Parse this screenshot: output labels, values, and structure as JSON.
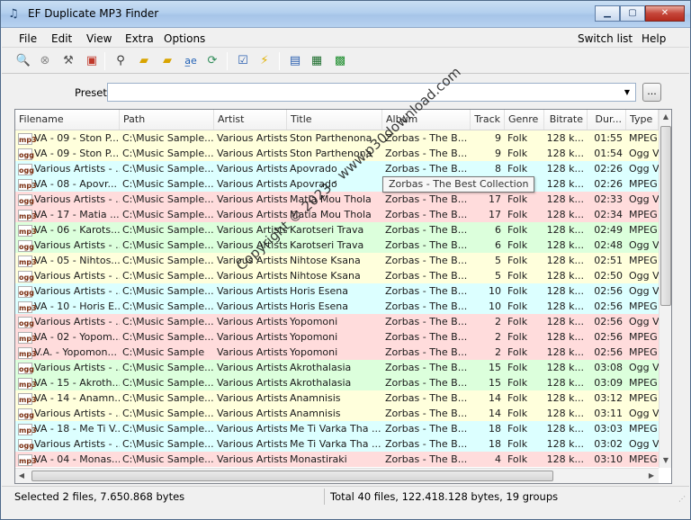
{
  "window": {
    "title": "EF Duplicate MP3 Finder",
    "app_icon": "music-notes-icon"
  },
  "menu": {
    "items": [
      "File",
      "Edit",
      "View",
      "Extra",
      "Options"
    ],
    "switch_list": "Switch list",
    "help": "Help"
  },
  "toolbar": {
    "icons": [
      "search-icon",
      "stop-icon",
      "hammer-icon",
      "file-clear-icon",
      "binoculars-icon",
      "folder-open-icon",
      "folder-add-icon",
      "spell-check-icon",
      "refresh-icon",
      "checklist-icon",
      "lightning-icon",
      "document-icon",
      "export-icon",
      "save-icon"
    ]
  },
  "preset": {
    "label": "Preset",
    "value": "",
    "button": "..."
  },
  "columns": [
    "Filename",
    "Path",
    "Artist",
    "Title",
    "Album",
    "Track",
    "Genre",
    "Bitrate",
    "Dur...",
    "Type"
  ],
  "rows": [
    {
      "icon": "mp3",
      "filename": "VA - 09 - Ston P...",
      "path": "C:\\Music Sample...",
      "artist": "Various Artists",
      "title": "Ston Parthenona",
      "album": "Zorbas - The B...",
      "track": "9",
      "genre": "Folk",
      "bitrate": "128 k...",
      "duration": "01:55",
      "type": "MPEG",
      "color": "yellow"
    },
    {
      "icon": "ogg",
      "filename": "VA - 09 - Ston P...",
      "path": "C:\\Music Sample...",
      "artist": "Various Artists",
      "title": "Ston Parthenona",
      "album": "Zorbas - The B...",
      "track": "9",
      "genre": "Folk",
      "bitrate": "128 k...",
      "duration": "01:54",
      "type": "Ogg V",
      "color": "yellow"
    },
    {
      "icon": "ogg",
      "filename": "Various Artists - ...",
      "path": "C:\\Music Sample...",
      "artist": "Various Artists",
      "title": "Apovrado",
      "album": "Zorbas - The B...",
      "track": "8",
      "genre": "Folk",
      "bitrate": "128 k...",
      "duration": "02:26",
      "type": "Ogg V",
      "color": "cyan"
    },
    {
      "icon": "mp3",
      "filename": "VA - 08 - Apovr...",
      "path": "C:\\Music Sample...",
      "artist": "Various Artists",
      "title": "Apovrado",
      "album": "Zorbas - The B...",
      "track": "8",
      "genre": "Folk",
      "bitrate": "128 k...",
      "duration": "02:26",
      "type": "MPEG",
      "color": "cyan"
    },
    {
      "icon": "ogg",
      "filename": "Various Artists - ...",
      "path": "C:\\Music Sample...",
      "artist": "Various Artists",
      "title": "Matia Mou Thola",
      "album": "Zorbas - The B...",
      "track": "17",
      "genre": "Folk",
      "bitrate": "128 k...",
      "duration": "02:33",
      "type": "Ogg V",
      "color": "pink"
    },
    {
      "icon": "mp3",
      "filename": "VA - 17 - Matia ...",
      "path": "C:\\Music Sample...",
      "artist": "Various Artists",
      "title": "Matia Mou Thola",
      "album": "Zorbas - The B...",
      "track": "17",
      "genre": "Folk",
      "bitrate": "128 k...",
      "duration": "02:34",
      "type": "MPEG",
      "color": "pink"
    },
    {
      "icon": "mp3",
      "filename": "VA - 06 - Karots...",
      "path": "C:\\Music Sample...",
      "artist": "Various Artists",
      "title": "Karotseri Trava",
      "album": "Zorbas - The B...",
      "track": "6",
      "genre": "Folk",
      "bitrate": "128 k...",
      "duration": "02:49",
      "type": "MPEG",
      "color": "green"
    },
    {
      "icon": "ogg",
      "filename": "Various Artists - ...",
      "path": "C:\\Music Sample...",
      "artist": "Various Artists",
      "title": "Karotseri Trava",
      "album": "Zorbas - The B...",
      "track": "6",
      "genre": "Folk",
      "bitrate": "128 k...",
      "duration": "02:48",
      "type": "Ogg V",
      "color": "green"
    },
    {
      "icon": "mp3",
      "filename": "VA - 05 - Nihtos...",
      "path": "C:\\Music Sample...",
      "artist": "Various Artists",
      "title": "Nihtose Ksana",
      "album": "Zorbas - The B...",
      "track": "5",
      "genre": "Folk",
      "bitrate": "128 k...",
      "duration": "02:51",
      "type": "MPEG",
      "color": "yellow"
    },
    {
      "icon": "ogg",
      "filename": "Various Artists - ...",
      "path": "C:\\Music Sample...",
      "artist": "Various Artists",
      "title": "Nihtose Ksana",
      "album": "Zorbas - The B...",
      "track": "5",
      "genre": "Folk",
      "bitrate": "128 k...",
      "duration": "02:50",
      "type": "Ogg V",
      "color": "yellow"
    },
    {
      "icon": "ogg",
      "filename": "Various Artists - ...",
      "path": "C:\\Music Sample...",
      "artist": "Various Artists",
      "title": "Horis Esena",
      "album": "Zorbas - The B...",
      "track": "10",
      "genre": "Folk",
      "bitrate": "128 k...",
      "duration": "02:56",
      "type": "Ogg V",
      "color": "cyan"
    },
    {
      "icon": "mp3",
      "filename": "VA - 10 - Horis E...",
      "path": "C:\\Music Sample...",
      "artist": "Various Artists",
      "title": "Horis Esena",
      "album": "Zorbas - The B...",
      "track": "10",
      "genre": "Folk",
      "bitrate": "128 k...",
      "duration": "02:56",
      "type": "MPEG",
      "color": "cyan"
    },
    {
      "icon": "ogg",
      "filename": "Various Artists - ...",
      "path": "C:\\Music Sample...",
      "artist": "Various Artists",
      "title": "Yopomoni",
      "album": "Zorbas - The B...",
      "track": "2",
      "genre": "Folk",
      "bitrate": "128 k...",
      "duration": "02:56",
      "type": "Ogg V",
      "color": "pink"
    },
    {
      "icon": "mp3",
      "filename": "VA - 02 - Yopom...",
      "path": "C:\\Music Sample...",
      "artist": "Various Artists",
      "title": "Yopomoni",
      "album": "Zorbas - The B...",
      "track": "2",
      "genre": "Folk",
      "bitrate": "128 k...",
      "duration": "02:56",
      "type": "MPEG",
      "color": "pink"
    },
    {
      "icon": "mp3",
      "filename": "V.A. - Yopomon...",
      "path": "C:\\Music Sample",
      "artist": "Various Artists",
      "title": "Yopomoni",
      "album": "Zorbas - The B...",
      "track": "2",
      "genre": "Folk",
      "bitrate": "128 k...",
      "duration": "02:56",
      "type": "MPEG",
      "color": "pink"
    },
    {
      "icon": "ogg",
      "filename": "Various Artists - ...",
      "path": "C:\\Music Sample...",
      "artist": "Various Artists",
      "title": "Akrothalasia",
      "album": "Zorbas - The B...",
      "track": "15",
      "genre": "Folk",
      "bitrate": "128 k...",
      "duration": "03:08",
      "type": "Ogg V",
      "color": "green"
    },
    {
      "icon": "mp3",
      "filename": "VA - 15 - Akroth...",
      "path": "C:\\Music Sample...",
      "artist": "Various Artists",
      "title": "Akrothalasia",
      "album": "Zorbas - The B...",
      "track": "15",
      "genre": "Folk",
      "bitrate": "128 k...",
      "duration": "03:09",
      "type": "MPEG",
      "color": "green"
    },
    {
      "icon": "mp3",
      "filename": "VA - 14 - Anamn...",
      "path": "C:\\Music Sample...",
      "artist": "Various Artists",
      "title": "Anamnisis",
      "album": "Zorbas - The B...",
      "track": "14",
      "genre": "Folk",
      "bitrate": "128 k...",
      "duration": "03:12",
      "type": "MPEG",
      "color": "yellow"
    },
    {
      "icon": "ogg",
      "filename": "Various Artists - ...",
      "path": "C:\\Music Sample...",
      "artist": "Various Artists",
      "title": "Anamnisis",
      "album": "Zorbas - The B...",
      "track": "14",
      "genre": "Folk",
      "bitrate": "128 k...",
      "duration": "03:11",
      "type": "Ogg V",
      "color": "yellow"
    },
    {
      "icon": "mp3",
      "filename": "VA - 18 - Me Ti V...",
      "path": "C:\\Music Sample...",
      "artist": "Various Artists",
      "title": "Me Ti Varka Tha ...",
      "album": "Zorbas - The B...",
      "track": "18",
      "genre": "Folk",
      "bitrate": "128 k...",
      "duration": "03:03",
      "type": "MPEG",
      "color": "cyan"
    },
    {
      "icon": "ogg",
      "filename": "Various Artists - ...",
      "path": "C:\\Music Sample...",
      "artist": "Various Artists",
      "title": "Me Ti Varka Tha ...",
      "album": "Zorbas - The B...",
      "track": "18",
      "genre": "Folk",
      "bitrate": "128 k...",
      "duration": "03:02",
      "type": "Ogg V",
      "color": "cyan"
    },
    {
      "icon": "mp3",
      "filename": "VA - 04 - Monas...",
      "path": "C:\\Music Sample...",
      "artist": "Various Artists",
      "title": "Monastiraki",
      "album": "Zorbas - The B...",
      "track": "4",
      "genre": "Folk",
      "bitrate": "128 k...",
      "duration": "03:10",
      "type": "MPEG",
      "color": "pink"
    }
  ],
  "row_colors": {
    "yellow": "#ffffdc",
    "cyan": "#dcffff",
    "pink": "#ffdcdc",
    "green": "#dcffdc"
  },
  "tooltip": "Zorbas - The Best Collection",
  "watermark": "Copyright © 2023 - www.p30download.com",
  "status": {
    "left": "Selected 2 files, 7.650.868 bytes",
    "right": "Total 40 files, 122.418.128 bytes, 19 groups"
  }
}
